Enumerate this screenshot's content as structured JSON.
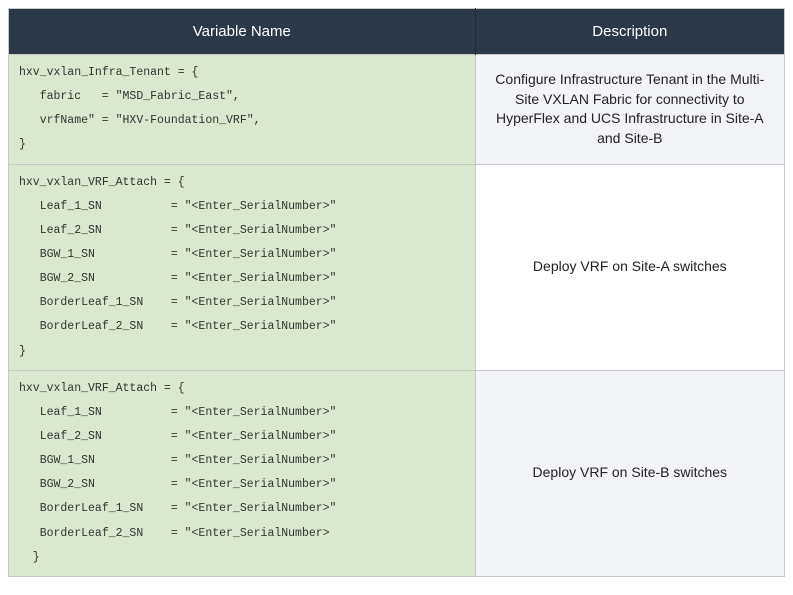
{
  "headers": {
    "var": "Variable Name",
    "desc": "Description"
  },
  "rows": [
    {
      "code": "hxv_vxlan_Infra_Tenant = {\n   fabric   = \"MSD_Fabric_East\",\n   vrfName\" = \"HXV-Foundation_VRF\",\n}",
      "desc": "Configure Infrastructure Tenant in the Multi-Site VXLAN Fabric for connectivity to HyperFlex and UCS Infrastructure in Site-A and Site-B"
    },
    {
      "code": "hxv_vxlan_VRF_Attach = {\n   Leaf_1_SN          = \"<Enter_SerialNumber>\"\n   Leaf_2_SN          = \"<Enter_SerialNumber>\"\n   BGW_1_SN           = \"<Enter_SerialNumber>\"\n   BGW_2_SN           = \"<Enter_SerialNumber>\"\n   BorderLeaf_1_SN    = \"<Enter_SerialNumber>\"\n   BorderLeaf_2_SN    = \"<Enter_SerialNumber>\"\n}",
      "desc": "Deploy VRF on Site-A switches"
    },
    {
      "code": "hxv_vxlan_VRF_Attach = {\n   Leaf_1_SN          = \"<Enter_SerialNumber>\"\n   Leaf_2_SN          = \"<Enter_SerialNumber>\"\n   BGW_1_SN           = \"<Enter_SerialNumber>\"\n   BGW_2_SN           = \"<Enter_SerialNumber>\"\n   BorderLeaf_1_SN    = \"<Enter_SerialNumber>\"\n   BorderLeaf_2_SN    = \"<Enter_SerialNumber>\n  }",
      "desc": "Deploy VRF on Site-B switches"
    }
  ]
}
